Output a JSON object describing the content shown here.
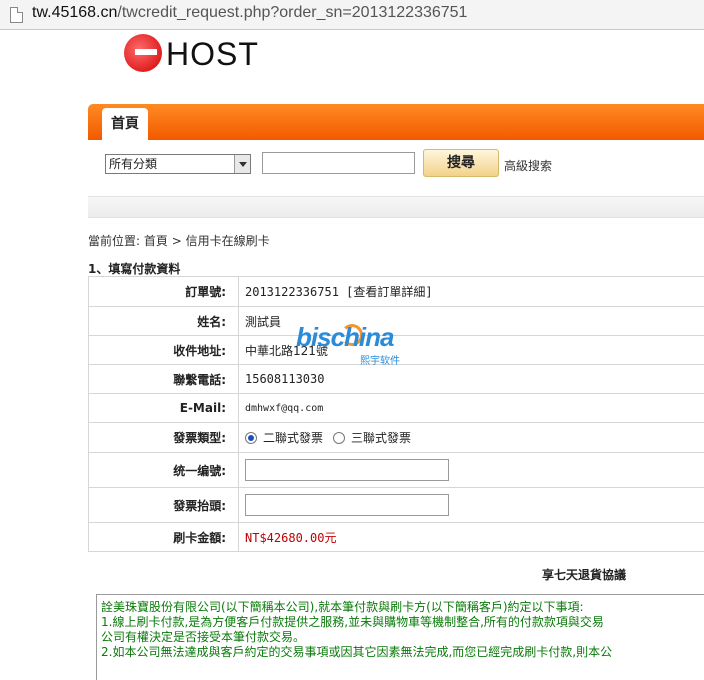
{
  "browser": {
    "url_host": "tw.45168.cn",
    "url_path": "/twcredit_request.php?order_sn=2013122336751"
  },
  "logo": {
    "text": "HOST"
  },
  "nav": {
    "tab_home": "首頁"
  },
  "search": {
    "category_selected": "所有分類",
    "button": "搜尋",
    "advanced_link": "高級搜索"
  },
  "breadcrumb": {
    "prefix": "當前位置:",
    "home": "首頁",
    "separator": ">",
    "current": "信用卡在線刷卡"
  },
  "section_title": "1、填寫付款資料",
  "form": {
    "order_no_label": "訂單號:",
    "order_no_value": "2013122336751 [查看訂單詳細]",
    "name_label": "姓名:",
    "name_value": "測試員",
    "address_label": "收件地址:",
    "address_value": "中華北路121號",
    "phone_label": "聯繫電話:",
    "phone_value": "15608113030",
    "email_label": "E-Mail:",
    "email_value": "dmhwxf@qq.com",
    "invoice_type_label": "發票類型:",
    "invoice_option1": "二聯式發票",
    "invoice_option2": "三聯式發票",
    "tax_id_label": "统一编號:",
    "invoice_title_label": "發票抬頭:",
    "amount_label": "刷卡金額:",
    "amount_value": "NT$42680.00元"
  },
  "agreement": {
    "title": "享七天退貨協議",
    "lines": [
      "詮美珠寶股份有限公司(以下簡稱本公司),就本筆付款與刷卡方(以下簡稱客戶)約定以下事項:",
      "1.線上刷卡付款,是為方便客戶付款提供之服務,並未與購物車等機制整合,所有的付款款項與交易",
      "公司有權決定是否接受本筆付款交易。",
      "2.如本公司無法達成與客戶約定的交易事項或因其它因素無法完成,而您已經完成刷卡付款,則本公"
    ]
  },
  "watermark": {
    "text": "bischina",
    "sub": "熙宇软件"
  }
}
